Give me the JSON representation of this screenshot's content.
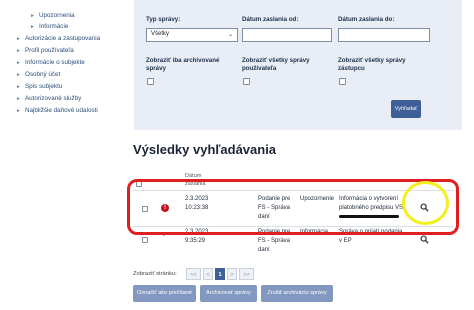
{
  "sidebar": {
    "items": [
      {
        "label": "Upozornenia",
        "sub": true
      },
      {
        "label": "Informácie",
        "sub": true
      },
      {
        "label": "Autorizácie a zastupovania",
        "sub": false
      },
      {
        "label": "Profil používateľa",
        "sub": false
      },
      {
        "label": "Informácie o subjekte",
        "sub": false
      },
      {
        "label": "Osobný účet",
        "sub": false
      },
      {
        "label": "Spis subjektu",
        "sub": false
      },
      {
        "label": "Autorizované služby",
        "sub": false
      },
      {
        "label": "Najbližšie daňové udalosti",
        "sub": false
      }
    ]
  },
  "filter": {
    "type_label": "Typ správy:",
    "type_value": "Všetky",
    "date_from_label": "Dátum zaslania od:",
    "date_to_label": "Dátum zaslania do:",
    "archived_only_label": "Zobraziť iba archivované správy",
    "all_user_msgs_label": "Zobraziť všetky správy používateľa",
    "all_rep_msgs_label": "Zobraziť všetky správy zástupcu",
    "search_button": "Vyhľadať"
  },
  "results": {
    "title": "Výsledky vyhľadávania",
    "header": {
      "date_line1": "Dátum",
      "date_line2": "zaslania"
    },
    "rows": [
      {
        "date": "2.3.2023",
        "time": "10:23:38",
        "source_line1": "Podanie pre",
        "source_line2": "FS - Správa",
        "source_line3": "daní",
        "type": "Upozornenie",
        "subject_line1": "Informácia o vytvorení",
        "subject_line2": "platobného predpisu VS:",
        "has_alert": true
      },
      {
        "date": "2.3.2023",
        "time": "9:35:29",
        "source_line1": "Podanie pre",
        "source_line2": "FS - Správa",
        "source_line3": "daní",
        "type": "Informácia",
        "subject_line1": "Správa o prijatí podania",
        "subject_line2": "v EP",
        "has_alert": false
      }
    ]
  },
  "pagination": {
    "label": "Zobraziť stránku:",
    "first": "<<",
    "prev": "<",
    "current": "1",
    "next": ">",
    "last": ">>"
  },
  "actions": {
    "mark_read": "Označiť ako prečítané",
    "archive": "Archivovať správy",
    "unarchive": "Zrušiť archiváciu správy"
  },
  "colors": {
    "primary": "#3f5f99",
    "panel_bg": "#e9eef6",
    "highlight_red": "#e02020",
    "highlight_yellow": "#f4ef1e",
    "alert_red": "#c4141b"
  }
}
